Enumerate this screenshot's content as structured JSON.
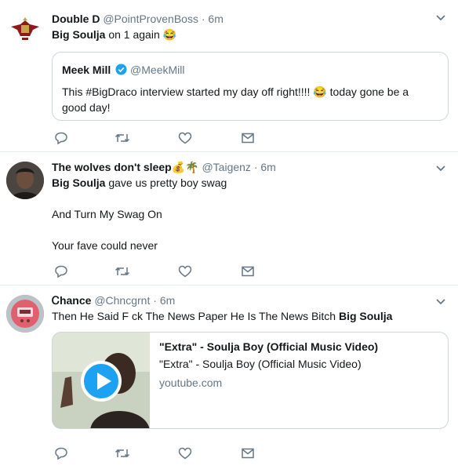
{
  "tweets": [
    {
      "name": "Double D",
      "handle": "@PointProvenBoss",
      "dot": "·",
      "time": "6m",
      "text_bold": "Big Soulja",
      "text_rest": " on 1 again ",
      "emoji": "😂",
      "avatar_icon": "crest-avatar",
      "quote": {
        "name": "Meek Mill",
        "handle": "@MeekMill",
        "text_line1": "This #BigDraco interview started my day off right!!!! ",
        "emoji": "😂",
        "text_line1_end": " today gone be a",
        "text_line2": "good day!"
      }
    },
    {
      "name": "The wolves don't sleep",
      "name_emojis": "💰🌴",
      "handle": "@Taigenz",
      "dot": "·",
      "time": "6m",
      "text_bold": "Big Soulja",
      "text_rest": " gave us pretty boy swag",
      "line2": "And Turn My Swag On",
      "line3": "Your fave could never",
      "avatar_icon": "portrait-avatar"
    },
    {
      "name": "Ꮯhance",
      "handle": "@Chncgrnt",
      "dot": "·",
      "time": "6m",
      "text_rest": "Then He Said F  ck The News Paper He Is The News Bitch ",
      "text_bold": "Big Soulja",
      "avatar_icon": "gadget-avatar",
      "card": {
        "title": "\"Extra\" - Soulja Boy (Official Music Video)",
        "description": "\"Extra\" - Soulja Boy (Official Music Video)",
        "domain": "youtube.com"
      }
    }
  ],
  "colors": {
    "accent": "#1da1f2",
    "muted": "#657786",
    "border": "#e6ecf0"
  }
}
